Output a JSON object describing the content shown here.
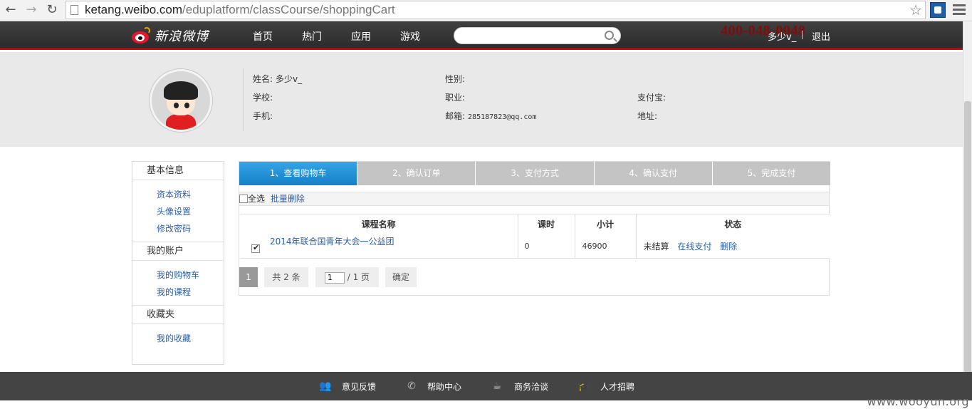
{
  "browser": {
    "url_host": "ketang.weibo.com",
    "url_path": "/eduplatform/classCourse/shoppingCart"
  },
  "header": {
    "logo_text": "新浪微博",
    "nav": [
      "首页",
      "热门",
      "应用",
      "游戏"
    ],
    "hotline": "400-048-0048",
    "username": "多少v_",
    "logout": "退出"
  },
  "profile": {
    "name_label": "姓名:",
    "name_value": "多少v_",
    "gender_label": "性别:",
    "school_label": "学校:",
    "job_label": "职业:",
    "alipay_label": "支付宝:",
    "phone_label": "手机:",
    "email_label": "邮箱:",
    "email_value": "285187823@qq.com",
    "address_label": "地址:"
  },
  "sidebar": {
    "sec1_title": "基本信息",
    "sec1_items": [
      "资本资料",
      "头像设置",
      "修改密码"
    ],
    "sec2_title": "我的账户",
    "sec2_items": [
      "我的购物车",
      "我的课程"
    ],
    "sec3_title": "收藏夹",
    "sec3_items": [
      "我的收藏"
    ]
  },
  "steps": [
    "1、查看购物车",
    "2、确认订单",
    "3、支付方式",
    "4、确认支付",
    "5、完成支付"
  ],
  "toolbar": {
    "select_all": "全选",
    "batch_delete": "批量删除"
  },
  "table": {
    "headers": [
      "课程名称",
      "课时",
      "小计",
      "状态"
    ],
    "rows": [
      {
        "course": "2014年联合国青年大会一公益团",
        "hours": "0",
        "subtotal": "46900",
        "status": "未结算",
        "pay": "在线支付",
        "delete": "删除"
      }
    ]
  },
  "pager": {
    "current": "1",
    "total_text": "共 2 条",
    "page_input": "1",
    "page_total": "/ 1 页",
    "confirm": "确定"
  },
  "footer": [
    "意见反馈",
    "帮助中心",
    "商务洽谈",
    "人才招聘"
  ],
  "watermark": "www.wooyun.org",
  "colors": {
    "accent": "#1a8ad3",
    "link": "#2b5fa8",
    "nav_bg": "#333333",
    "brand_red": "#e6162d"
  }
}
